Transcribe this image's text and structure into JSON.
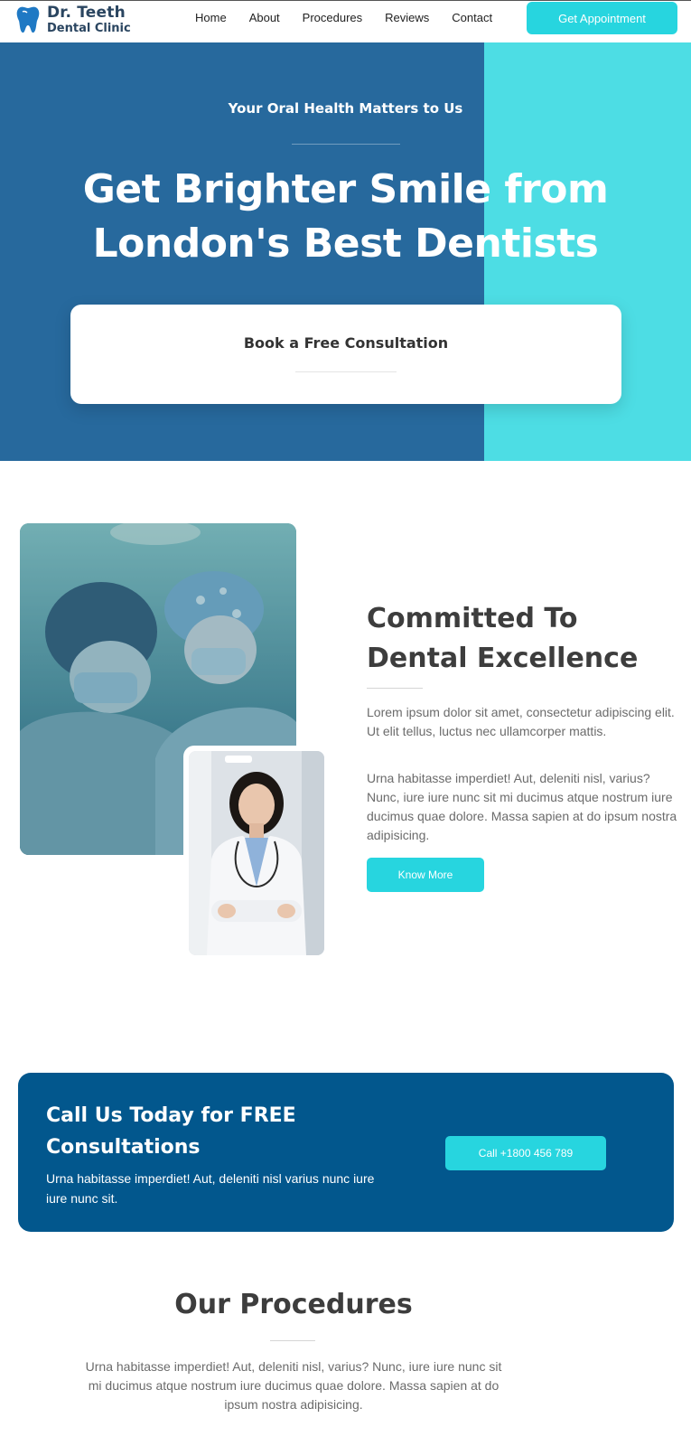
{
  "header": {
    "logo_line1": "Dr. Teeth",
    "logo_line2": "Dental Clinic",
    "nav": [
      "Home",
      "About",
      "Procedures",
      "Reviews",
      "Contact"
    ],
    "cta_label": "Get Appointment"
  },
  "hero": {
    "subtitle": "Your Oral Health Matters to Us",
    "title": "Get Brighter Smile from London's Best Dentists",
    "consult_label": "Book a Free Consultation"
  },
  "about": {
    "title": "Committed To Dental Excellence",
    "paragraph1": "Lorem ipsum dolor sit amet, consectetur adipiscing elit. Ut elit tellus, luctus nec ullamcorper mattis.",
    "paragraph2": "Urna habitasse imperdiet! Aut, deleniti nisl, varius? Nunc, iure iure nunc sit mi ducimus atque nostrum iure ducimus quae dolore. Massa sapien at do ipsum nostra adipisicing.",
    "button_label": "Know More"
  },
  "call": {
    "title": "Call Us Today for FREE Consultations",
    "text": "Urna habitasse imperdiet! Aut, deleniti nisl varius nunc iure iure nunc sit.",
    "button_label": "Call +1800 456 789"
  },
  "procedures": {
    "title": "Our Procedures",
    "text": "Urna habitasse imperdiet! Aut, deleniti nisl, varius? Nunc, iure iure nunc sit mi ducimus atque nostrum iure ducimus quae dolore. Massa sapien at do ipsum nostra adipisicing."
  },
  "colors": {
    "accent": "#27d5df",
    "hero_blue": "#27699d",
    "hero_cyan": "#4ddde4",
    "banner_blue": "#02578d"
  }
}
